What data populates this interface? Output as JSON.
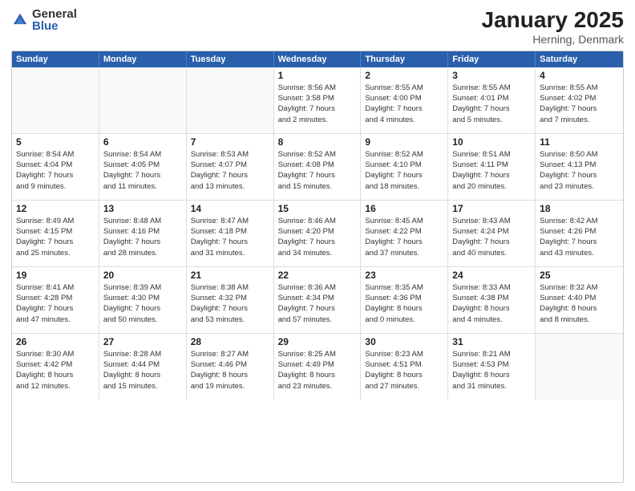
{
  "logo": {
    "general": "General",
    "blue": "Blue"
  },
  "title": "January 2025",
  "location": "Herning, Denmark",
  "weekdays": [
    "Sunday",
    "Monday",
    "Tuesday",
    "Wednesday",
    "Thursday",
    "Friday",
    "Saturday"
  ],
  "weeks": [
    [
      {
        "day": "",
        "info": ""
      },
      {
        "day": "",
        "info": ""
      },
      {
        "day": "",
        "info": ""
      },
      {
        "day": "1",
        "info": "Sunrise: 8:56 AM\nSunset: 3:58 PM\nDaylight: 7 hours\nand 2 minutes."
      },
      {
        "day": "2",
        "info": "Sunrise: 8:55 AM\nSunset: 4:00 PM\nDaylight: 7 hours\nand 4 minutes."
      },
      {
        "day": "3",
        "info": "Sunrise: 8:55 AM\nSunset: 4:01 PM\nDaylight: 7 hours\nand 5 minutes."
      },
      {
        "day": "4",
        "info": "Sunrise: 8:55 AM\nSunset: 4:02 PM\nDaylight: 7 hours\nand 7 minutes."
      }
    ],
    [
      {
        "day": "5",
        "info": "Sunrise: 8:54 AM\nSunset: 4:04 PM\nDaylight: 7 hours\nand 9 minutes."
      },
      {
        "day": "6",
        "info": "Sunrise: 8:54 AM\nSunset: 4:05 PM\nDaylight: 7 hours\nand 11 minutes."
      },
      {
        "day": "7",
        "info": "Sunrise: 8:53 AM\nSunset: 4:07 PM\nDaylight: 7 hours\nand 13 minutes."
      },
      {
        "day": "8",
        "info": "Sunrise: 8:52 AM\nSunset: 4:08 PM\nDaylight: 7 hours\nand 15 minutes."
      },
      {
        "day": "9",
        "info": "Sunrise: 8:52 AM\nSunset: 4:10 PM\nDaylight: 7 hours\nand 18 minutes."
      },
      {
        "day": "10",
        "info": "Sunrise: 8:51 AM\nSunset: 4:11 PM\nDaylight: 7 hours\nand 20 minutes."
      },
      {
        "day": "11",
        "info": "Sunrise: 8:50 AM\nSunset: 4:13 PM\nDaylight: 7 hours\nand 23 minutes."
      }
    ],
    [
      {
        "day": "12",
        "info": "Sunrise: 8:49 AM\nSunset: 4:15 PM\nDaylight: 7 hours\nand 25 minutes."
      },
      {
        "day": "13",
        "info": "Sunrise: 8:48 AM\nSunset: 4:16 PM\nDaylight: 7 hours\nand 28 minutes."
      },
      {
        "day": "14",
        "info": "Sunrise: 8:47 AM\nSunset: 4:18 PM\nDaylight: 7 hours\nand 31 minutes."
      },
      {
        "day": "15",
        "info": "Sunrise: 8:46 AM\nSunset: 4:20 PM\nDaylight: 7 hours\nand 34 minutes."
      },
      {
        "day": "16",
        "info": "Sunrise: 8:45 AM\nSunset: 4:22 PM\nDaylight: 7 hours\nand 37 minutes."
      },
      {
        "day": "17",
        "info": "Sunrise: 8:43 AM\nSunset: 4:24 PM\nDaylight: 7 hours\nand 40 minutes."
      },
      {
        "day": "18",
        "info": "Sunrise: 8:42 AM\nSunset: 4:26 PM\nDaylight: 7 hours\nand 43 minutes."
      }
    ],
    [
      {
        "day": "19",
        "info": "Sunrise: 8:41 AM\nSunset: 4:28 PM\nDaylight: 7 hours\nand 47 minutes."
      },
      {
        "day": "20",
        "info": "Sunrise: 8:39 AM\nSunset: 4:30 PM\nDaylight: 7 hours\nand 50 minutes."
      },
      {
        "day": "21",
        "info": "Sunrise: 8:38 AM\nSunset: 4:32 PM\nDaylight: 7 hours\nand 53 minutes."
      },
      {
        "day": "22",
        "info": "Sunrise: 8:36 AM\nSunset: 4:34 PM\nDaylight: 7 hours\nand 57 minutes."
      },
      {
        "day": "23",
        "info": "Sunrise: 8:35 AM\nSunset: 4:36 PM\nDaylight: 8 hours\nand 0 minutes."
      },
      {
        "day": "24",
        "info": "Sunrise: 8:33 AM\nSunset: 4:38 PM\nDaylight: 8 hours\nand 4 minutes."
      },
      {
        "day": "25",
        "info": "Sunrise: 8:32 AM\nSunset: 4:40 PM\nDaylight: 8 hours\nand 8 minutes."
      }
    ],
    [
      {
        "day": "26",
        "info": "Sunrise: 8:30 AM\nSunset: 4:42 PM\nDaylight: 8 hours\nand 12 minutes."
      },
      {
        "day": "27",
        "info": "Sunrise: 8:28 AM\nSunset: 4:44 PM\nDaylight: 8 hours\nand 15 minutes."
      },
      {
        "day": "28",
        "info": "Sunrise: 8:27 AM\nSunset: 4:46 PM\nDaylight: 8 hours\nand 19 minutes."
      },
      {
        "day": "29",
        "info": "Sunrise: 8:25 AM\nSunset: 4:49 PM\nDaylight: 8 hours\nand 23 minutes."
      },
      {
        "day": "30",
        "info": "Sunrise: 8:23 AM\nSunset: 4:51 PM\nDaylight: 8 hours\nand 27 minutes."
      },
      {
        "day": "31",
        "info": "Sunrise: 8:21 AM\nSunset: 4:53 PM\nDaylight: 8 hours\nand 31 minutes."
      },
      {
        "day": "",
        "info": ""
      }
    ]
  ]
}
